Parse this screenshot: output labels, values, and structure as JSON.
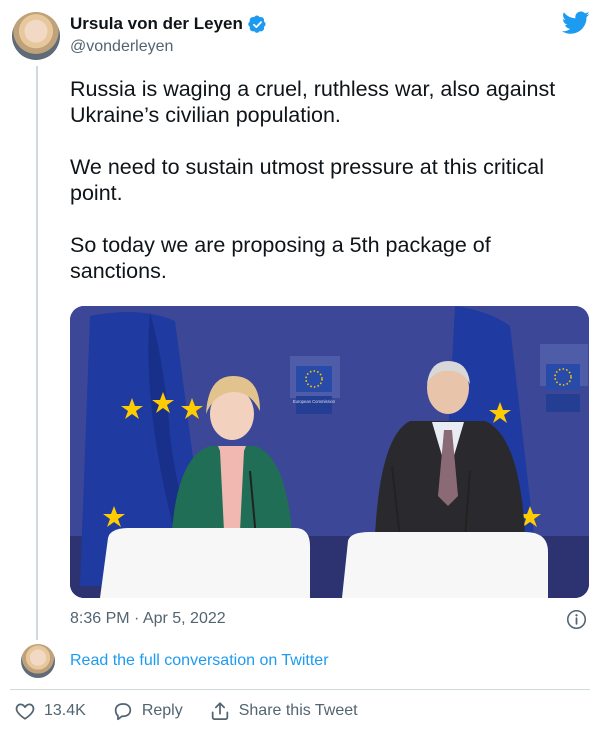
{
  "author": {
    "display_name": "Ursula von der Leyen",
    "handle": "@vonderleyen"
  },
  "tweet": {
    "paragraphs": [
      "Russia is waging a cruel, ruthless war, also against Ukraine’s civilian population.",
      "We need to sustain utmost pressure at this critical point.",
      "So today we are proposing a 5th package of sanctions."
    ],
    "timestamp": "8:36 PM · Apr 5, 2022"
  },
  "media": {
    "backdrop_logo_text": "European Commission"
  },
  "footer": {
    "read_link": "Read the full conversation on Twitter"
  },
  "actions": {
    "likes": "13.4K",
    "reply_label": "Reply",
    "share_label": "Share this Tweet"
  },
  "colors": {
    "twitter_blue": "#1d9bf0",
    "text": "#0f1419",
    "secondary_text": "#536471",
    "border": "#cfd9de",
    "eu_blue": "#003399",
    "eu_yellow": "#ffcc00"
  },
  "icons": [
    "verified-badge-icon",
    "twitter-bird-icon",
    "info-icon",
    "heart-icon",
    "reply-icon",
    "share-icon"
  ]
}
